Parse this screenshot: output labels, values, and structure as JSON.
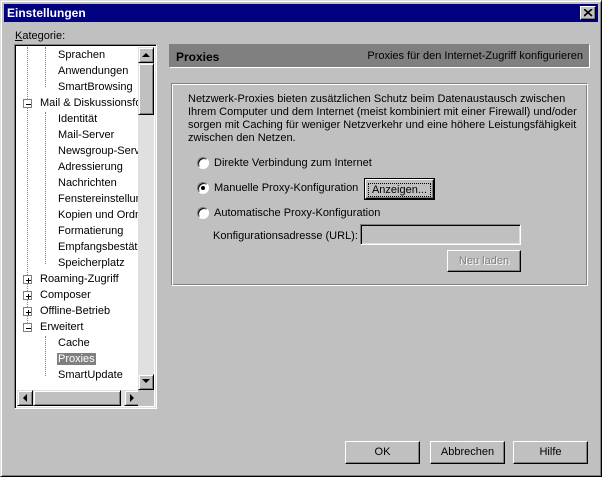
{
  "window": {
    "title": "Einstellungen"
  },
  "category_label": "Kategorie:",
  "tree": {
    "items": [
      {
        "label": "Sprachen"
      },
      {
        "label": "Anwendungen"
      },
      {
        "label": "SmartBrowsing"
      },
      {
        "label": "Mail & Diskussionsforen"
      },
      {
        "label": "Identität"
      },
      {
        "label": "Mail-Server"
      },
      {
        "label": "Newsgroup-Server"
      },
      {
        "label": "Adressierung"
      },
      {
        "label": "Nachrichten"
      },
      {
        "label": "Fenstereinstellungen"
      },
      {
        "label": "Kopien und Ordner"
      },
      {
        "label": "Formatierung"
      },
      {
        "label": "Empfangsbestät."
      },
      {
        "label": "Speicherplatz"
      },
      {
        "label": "Roaming-Zugriff"
      },
      {
        "label": "Composer"
      },
      {
        "label": "Offline-Betrieb"
      },
      {
        "label": "Erweitert"
      },
      {
        "label": "Cache"
      },
      {
        "label": "Proxies"
      },
      {
        "label": "SmartUpdate"
      }
    ],
    "selected": "Proxies"
  },
  "panel": {
    "title": "Proxies",
    "subtitle": "Proxies für den Internet-Zugriff konfigurieren",
    "description": "Netzwerk-Proxies bieten zusätzlichen Schutz beim Datenaustausch zwischen Ihrem Computer und dem Internet (meist kombiniert mit einer Firewall) und/oder sorgen mit Caching für weniger Netzverkehr und eine höhere Leistungsfähigkeit zwischen den Netzen.",
    "options": [
      {
        "label": "Direkte Verbindung zum Internet",
        "checked": false
      },
      {
        "label": "Manuelle Proxy-Konfiguration",
        "checked": true
      },
      {
        "label": "Automatische Proxy-Konfiguration",
        "checked": false
      }
    ],
    "view_button": "Anzeigen...",
    "url_label": "Konfigurationsadresse (URL):",
    "url_value": "",
    "reload_button": "Neu laden"
  },
  "footer": {
    "ok": "OK",
    "cancel": "Abbrechen",
    "help": "Hilfe"
  }
}
